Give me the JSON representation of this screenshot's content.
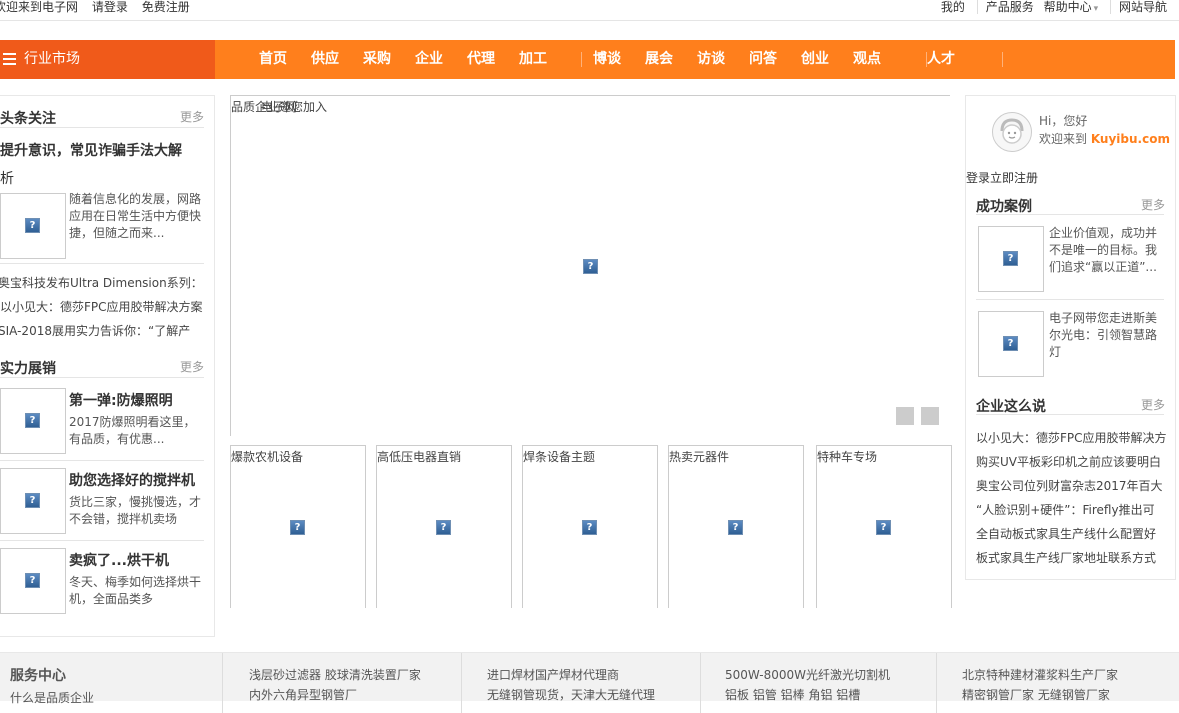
{
  "topbar": {
    "welcome": "欢迎来到电子网",
    "login": "请登录",
    "register": "免费注册",
    "mine": "我的",
    "products": "产品服务",
    "help": "帮助中心",
    "nav": "网站导航"
  },
  "nav": {
    "category": "行业市场",
    "items": [
      "首页",
      "供应",
      "采购",
      "企业",
      "代理",
      "加工",
      "博谈",
      "展会",
      "访谈",
      "问答",
      "创业",
      "观点",
      "人才"
    ]
  },
  "left": {
    "headline": {
      "title": "头条关注",
      "more": "更多",
      "lead_title_1": "提升意识，常见诈骗手法大解",
      "lead_title_2": "析",
      "lead_desc": "随着信息化的发展，网路应用在日常生活中方便快捷，但随之而来...",
      "lines": [
        "奥宝科技发布Ultra Dimension系列：",
        "以小见大：德莎FPC应用胶带解决方案",
        "SIA-2018展用实力告诉你：“了解产"
      ]
    },
    "promo": {
      "title": "实力展销",
      "more": "更多",
      "items": [
        {
          "title": "第一弹:防爆照明",
          "desc": "2017防爆照明看这里，有品质，有优惠..."
        },
        {
          "title": "助您选择好的搅拌机",
          "desc": "货比三家，慢挑慢选，才不会错，搅拌机卖场"
        },
        {
          "title": "卖疯了...烘干机",
          "desc": "冬天、梅季如何选择烘干机，全面品类多"
        }
      ]
    }
  },
  "center": {
    "slider_caption_a": "品质企业邀您加入",
    "slider_caption_b": "电子网",
    "cards": [
      "爆款农机设备",
      "高低压电器直销",
      "焊条设备主题",
      "热卖元器件",
      "特种车专场"
    ]
  },
  "right": {
    "greeting": "Hi，您好",
    "welcome_prefix": "欢迎来到",
    "brand": "Kuyibu.com",
    "login_register": "登录立即注册",
    "cases": {
      "title": "成功案例",
      "more": "更多",
      "items": [
        {
          "desc": "企业价值观，成功并不是唯一的目标。我们追求“赢以正道”..."
        },
        {
          "desc": "电子网带您走进斯美尔光电：引领智慧路灯"
        }
      ]
    },
    "talk": {
      "title": "企业这么说",
      "more": "更多",
      "lines": [
        "以小见大：德莎FPC应用胶带解决方",
        "购买UV平板彩印机之前应该要明白",
        "奥宝公司位列财富杂志2017年百大",
        "“人脸识别+硬件”：Firefly推出可",
        "全自动板式家具生产线什么配置好",
        "板式家具生产线厂家地址联系方式"
      ]
    }
  },
  "bottom": {
    "service_title": "服务中心",
    "service_sub": "什么是品质企业",
    "cols": [
      [
        "浅层砂过滤器 胶球清洗装置厂家",
        "内外六角异型钢管厂"
      ],
      [
        "进口焊材国产焊材代理商",
        "无缝钢管现货，天津大无缝代理"
      ],
      [
        "500W-8000W光纤激光切割机",
        "铝板 铝管 铝棒 角铝 铝槽"
      ],
      [
        "北京特种建材灌浆料生产厂家",
        "精密钢管厂家 无缝钢管厂家"
      ]
    ]
  }
}
